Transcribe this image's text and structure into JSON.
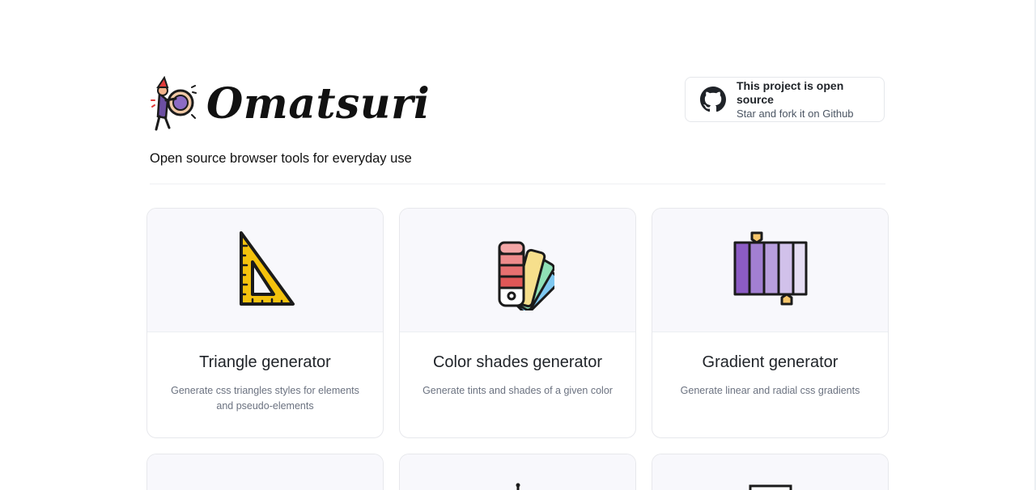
{
  "brand": {
    "name": "Omatsuri",
    "tagline": "Open source browser tools for everyday use",
    "logo_icon": "mascot-icon"
  },
  "github": {
    "title": "This project is open source",
    "subtitle": "Star and fork it on Github",
    "icon": "github-icon"
  },
  "tools": [
    {
      "title": "Triangle generator",
      "description": "Generate css triangles styles for elements and pseudo-elements",
      "icon": "set-square-icon"
    },
    {
      "title": "Color shades generator",
      "description": "Generate tints and shades of a given color",
      "icon": "color-swatch-icon"
    },
    {
      "title": "Gradient generator",
      "description": "Generate linear and radial css gradients",
      "icon": "gradient-icon"
    }
  ],
  "colors": {
    "triangle_yellow": "#f4c20d",
    "gradient_purple": "#8c5cc4",
    "card_top_bg": "#f8f8fc"
  }
}
